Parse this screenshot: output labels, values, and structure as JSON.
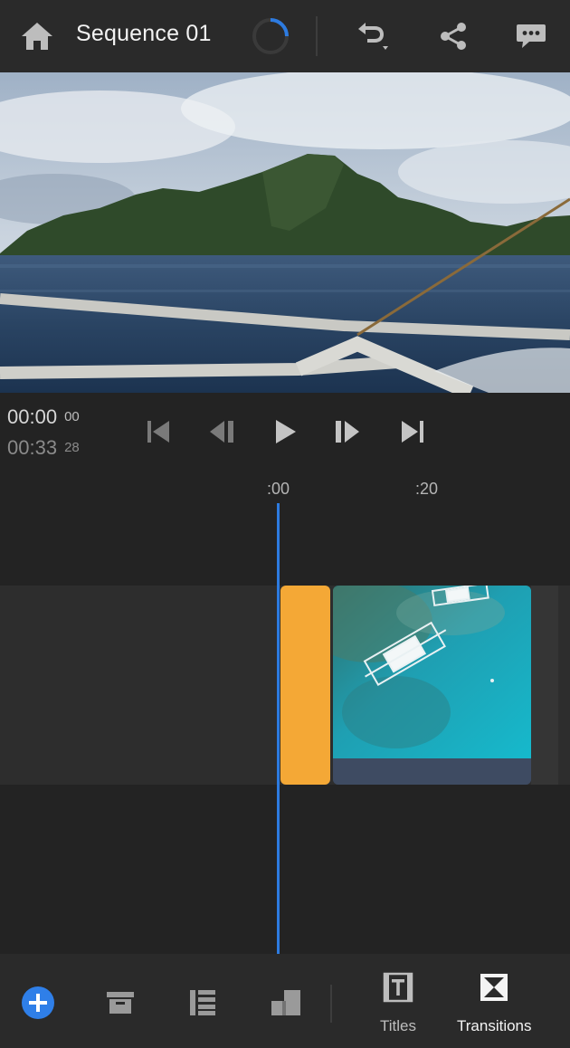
{
  "header": {
    "title": "Sequence 01",
    "icons": [
      "home-icon",
      "progress-spinner",
      "undo-icon",
      "share-icon",
      "feedback-icon"
    ]
  },
  "timecode": {
    "current_main": "00:00",
    "current_frames": "00",
    "duration_main": "00:33",
    "duration_frames": "28"
  },
  "transport": {
    "icons": [
      "skip-to-start-icon",
      "step-back-icon",
      "play-icon",
      "step-forward-icon",
      "skip-to-end-icon"
    ]
  },
  "timeline": {
    "ruler": [
      ":00",
      ":20"
    ],
    "clips": [
      {
        "kind": "transition",
        "color": "#f4a836"
      },
      {
        "kind": "video",
        "thumbnail": "aerial-boats-reef"
      }
    ],
    "playhead_color": "#2d7be0"
  },
  "toolbar": {
    "add_color": "#2f7fe8",
    "icons": [
      "add-icon",
      "archive-icon",
      "list-icon",
      "aspect-icon"
    ],
    "titles_label": "Titles",
    "transitions_label": "Transitions"
  }
}
